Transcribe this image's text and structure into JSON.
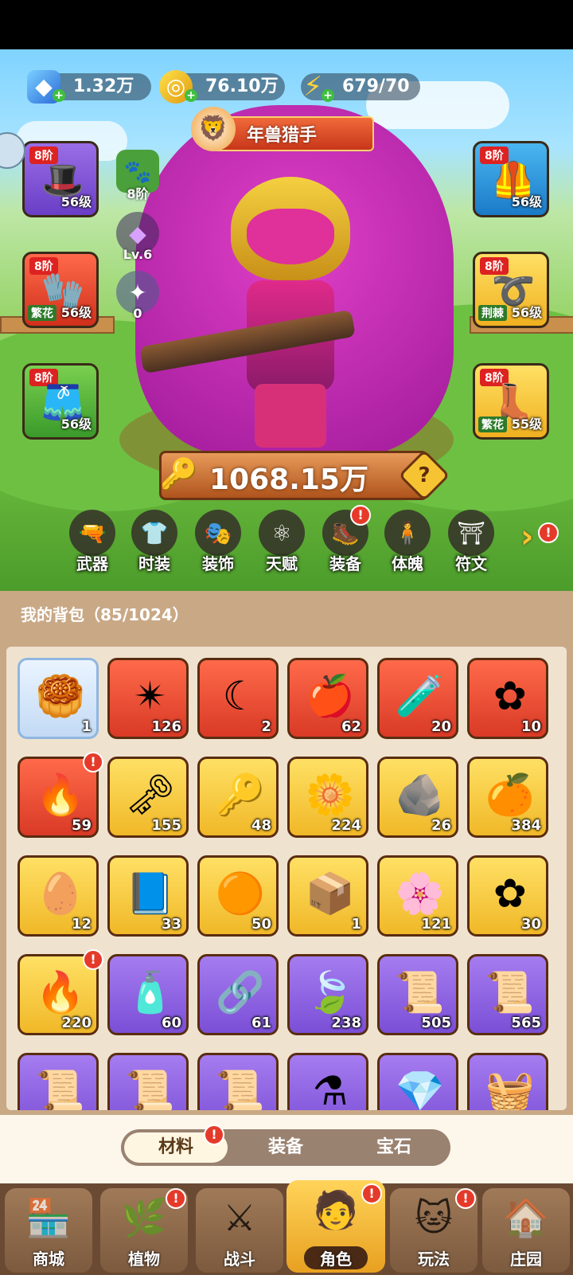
{
  "resources": {
    "gems": "1.32万",
    "gold": "76.10万",
    "energy": "679/70"
  },
  "character": {
    "title": "年兽猎手",
    "power": "1068.15万",
    "pet_level": "8阶",
    "crystal_level": "Lv.6",
    "orb_count": "0"
  },
  "equipment_left": [
    {
      "tier": "8阶",
      "level": "56级",
      "tag": ""
    },
    {
      "tier": "8阶",
      "level": "56级",
      "tag": "繁花"
    },
    {
      "tier": "8阶",
      "level": "56级",
      "tag": ""
    }
  ],
  "equipment_right": [
    {
      "tier": "8阶",
      "level": "56级",
      "tag": ""
    },
    {
      "tier": "8阶",
      "level": "56级",
      "tag": "荆棘"
    },
    {
      "tier": "8阶",
      "level": "55级",
      "tag": "繁花"
    }
  ],
  "tabs": [
    "武器",
    "时装",
    "装饰",
    "天赋",
    "装备",
    "体魄",
    "符文"
  ],
  "bag": {
    "title": "我的背包（85/1024）",
    "items": [
      {
        "count": "1",
        "color": "w",
        "icon": "gold-ingot"
      },
      {
        "count": "126",
        "color": "r",
        "icon": "star-crystal"
      },
      {
        "count": "2",
        "color": "r",
        "icon": "moon-star"
      },
      {
        "count": "62",
        "color": "r",
        "icon": "red-potion"
      },
      {
        "count": "20",
        "color": "r",
        "icon": "green-capsule"
      },
      {
        "count": "10",
        "color": "r",
        "icon": "knot-emblem"
      },
      {
        "count": "59",
        "color": "r",
        "icon": "fire-up"
      },
      {
        "count": "155",
        "color": "y",
        "icon": "purple-key"
      },
      {
        "count": "48",
        "color": "y",
        "icon": "gem-key"
      },
      {
        "count": "224",
        "color": "y",
        "icon": "golden-flower"
      },
      {
        "count": "26",
        "color": "y",
        "icon": "rune-stone"
      },
      {
        "count": "384",
        "color": "y",
        "icon": "orange-potion"
      },
      {
        "count": "12",
        "color": "y",
        "icon": "gold-ore"
      },
      {
        "count": "33",
        "color": "y",
        "icon": "spell-book"
      },
      {
        "count": "50",
        "color": "y",
        "icon": "copper-ore"
      },
      {
        "count": "1",
        "color": "y",
        "icon": "weapon-chest"
      },
      {
        "count": "121",
        "color": "y",
        "icon": "lily-flower"
      },
      {
        "count": "30",
        "color": "y",
        "icon": "knot-emblem"
      },
      {
        "count": "220",
        "color": "y",
        "icon": "golden-flame"
      },
      {
        "count": "60",
        "color": "p",
        "icon": "purple-potion"
      },
      {
        "count": "61",
        "color": "p",
        "icon": "silver-key"
      },
      {
        "count": "238",
        "color": "p",
        "icon": "leaf"
      },
      {
        "count": "505",
        "color": "p",
        "icon": "green-scroll"
      },
      {
        "count": "565",
        "color": "p",
        "icon": "purple-scroll"
      },
      {
        "count": "",
        "color": "p",
        "icon": "blue-scroll"
      },
      {
        "count": "",
        "color": "p",
        "icon": "red-scroll"
      },
      {
        "count": "",
        "color": "p",
        "icon": "gold-scroll"
      },
      {
        "count": "",
        "color": "p",
        "icon": "potion"
      },
      {
        "count": "",
        "color": "p",
        "icon": "blue-gem"
      },
      {
        "count": "",
        "color": "p",
        "icon": "fruit-basket"
      }
    ]
  },
  "segments": [
    "材料",
    "装备",
    "宝石"
  ],
  "nav": [
    "商城",
    "植物",
    "战斗",
    "角色",
    "玩法",
    "庄园"
  ]
}
